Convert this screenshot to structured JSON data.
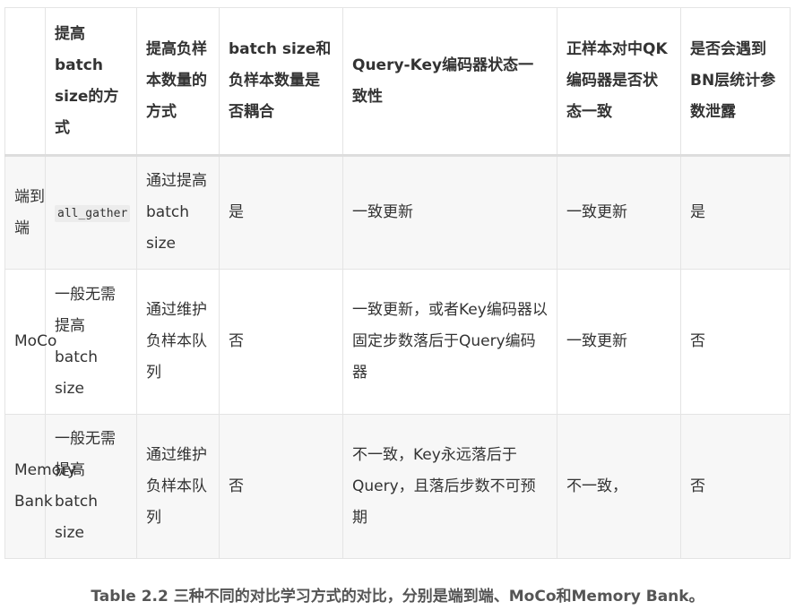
{
  "table": {
    "headers": [
      "",
      "提高batch size的方式",
      "提高负样本数量的方式",
      "batch size和负样本数量是否耦合",
      "Query-Key编码器状态一致性",
      "正样本对中QK编码器是否状态一致",
      "是否会遇到BN层统计参数泄露"
    ],
    "rows": [
      [
        "端到端",
        "all_gather",
        "通过提高batch size",
        "是",
        "一致更新",
        "一致更新",
        "是"
      ],
      [
        "MoCo",
        "一般无需提高batch size",
        "通过维护负样本队列",
        "否",
        "一致更新，或者Key编码器以固定步数落后于Query编码器",
        "一致更新",
        "否"
      ],
      [
        "Memory Bank",
        "一般无需提高batch size",
        "通过维护负样本队列",
        "否",
        "不一致，Key永远落后于Query，且落后步数不可预期",
        "不一致，",
        "否"
      ]
    ]
  },
  "caption": "Table 2.2 三种不同的对比学习方式的对比，分别是端到端、MoCo和Memory Bank。"
}
